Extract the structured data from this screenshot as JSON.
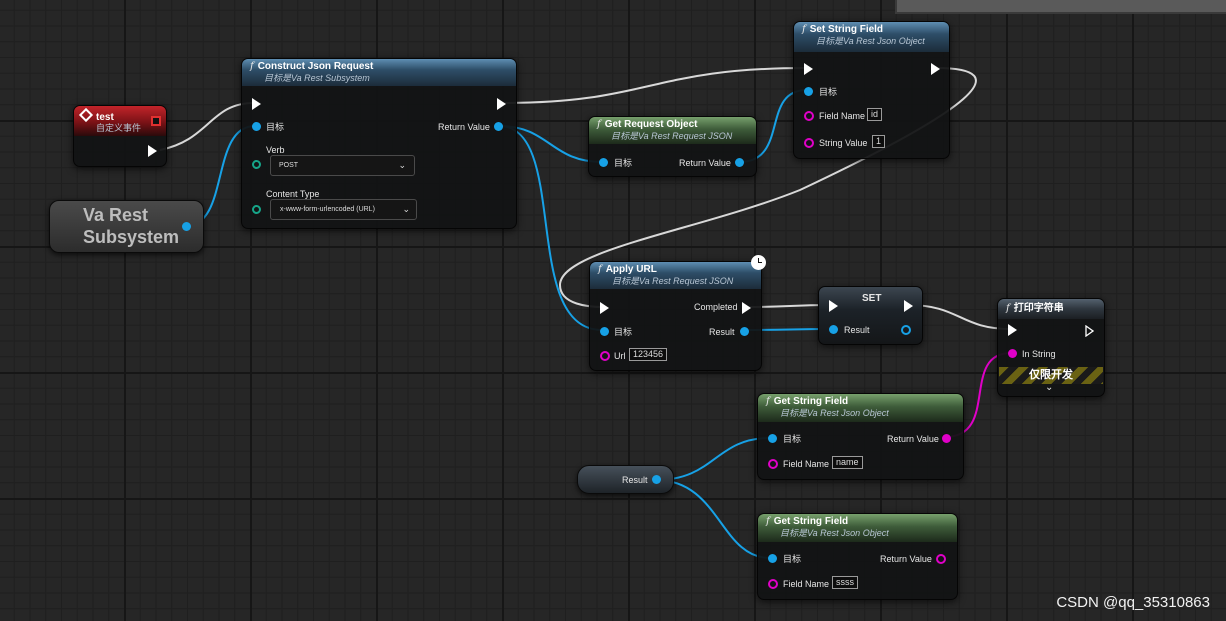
{
  "colors": {
    "exec": "#ffffff",
    "object_pin": "#17a1e6",
    "string_pin": "#e000c8",
    "enum_pin": "#16a589",
    "function_header": "#3e6a8c",
    "pure_header": "#4a6b40",
    "event_header": "#a41c21"
  },
  "event_node": {
    "title": "test",
    "subtitle": "自定义事件"
  },
  "subsystem_var": {
    "line1": "Va Rest",
    "line2": "Subsystem"
  },
  "construct": {
    "icon": "function-icon",
    "title": "Construct Json Request",
    "subtitle": "目标是Va Rest Subsystem",
    "target_label": "目标",
    "return_label": "Return Value",
    "verb_label": "Verb",
    "verb_value": "POST",
    "content_type_label": "Content Type",
    "content_type_value": "x-www-form-urlencoded (URL)"
  },
  "get_request_object": {
    "title": "Get Request Object",
    "subtitle": "目标是Va Rest Request JSON",
    "target_label": "目标",
    "return_label": "Return Value"
  },
  "set_string_field": {
    "title": "Set String Field",
    "subtitle": "目标是Va Rest Json Object",
    "target_label": "目标",
    "field_name_label": "Field Name",
    "field_name_value": "id",
    "string_value_label": "String Value",
    "string_value_value": "1"
  },
  "apply_url": {
    "title": "Apply URL",
    "subtitle": "目标是Va Rest Request JSON",
    "target_label": "目标",
    "completed_label": "Completed",
    "result_label": "Result",
    "url_label": "Url",
    "url_value": "123456"
  },
  "set_node": {
    "title": "SET",
    "result_label": "Result"
  },
  "print_string": {
    "title": "打印字符串",
    "in_string_label": "In String",
    "dev_only_label": "仅限开发"
  },
  "get_string_field_1": {
    "title": "Get String Field",
    "subtitle": "目标是Va Rest Json Object",
    "target_label": "目标",
    "return_label": "Return Value",
    "field_name_label": "Field Name",
    "field_name_value": "name"
  },
  "get_string_field_2": {
    "title": "Get String Field",
    "subtitle": "目标是Va Rest Json Object",
    "target_label": "目标",
    "return_label": "Return Value",
    "field_name_label": "Field Name",
    "field_name_value": "ssss"
  },
  "result_var": {
    "label": "Result"
  },
  "watermark": "CSDN @qq_35310863"
}
